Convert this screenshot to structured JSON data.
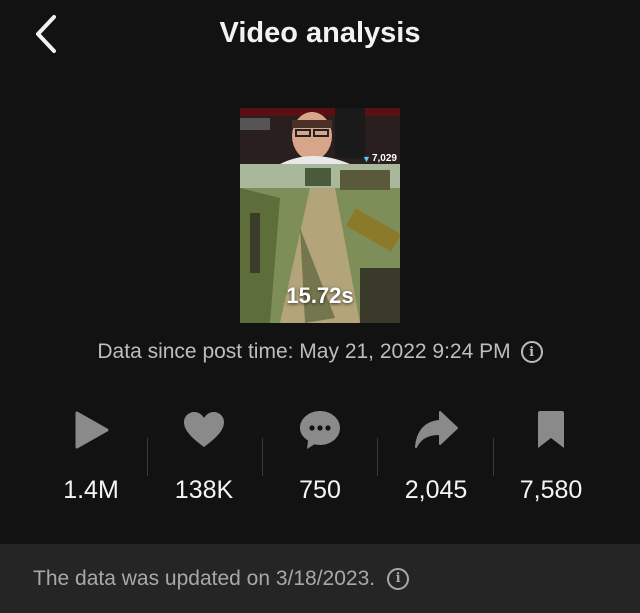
{
  "header": {
    "title": "Video analysis",
    "back_icon": "chevron-left-icon"
  },
  "video": {
    "duration": "15.72s",
    "overlay_count": "7,029"
  },
  "since": {
    "text": "Data since post time: May 21, 2022 9:24 PM",
    "icon": "info-icon"
  },
  "stats": [
    {
      "name": "views",
      "icon": "play-icon",
      "value": "1.4M"
    },
    {
      "name": "likes",
      "icon": "heart-icon",
      "value": "138K"
    },
    {
      "name": "comments",
      "icon": "comment-icon",
      "value": "750"
    },
    {
      "name": "shares",
      "icon": "share-icon",
      "value": "2,045"
    },
    {
      "name": "saves",
      "icon": "bookmark-icon",
      "value": "7,580"
    }
  ],
  "footer": {
    "text": "The data was updated on 3/18/2023.",
    "icon": "info-icon"
  },
  "colors": {
    "background": "#121212",
    "footer_background": "#252525",
    "icon_gray": "#8a8a8a"
  }
}
